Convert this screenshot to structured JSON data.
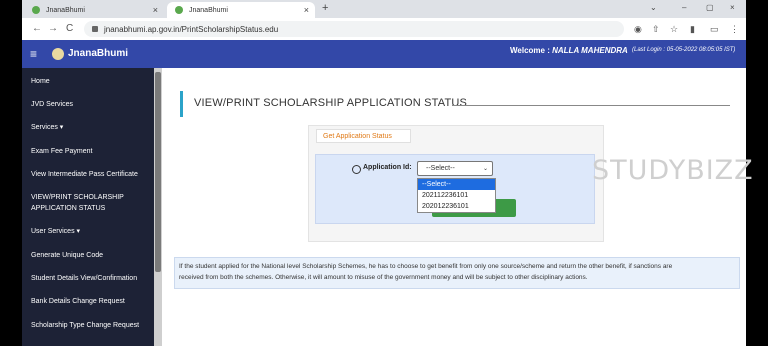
{
  "tabs": [
    {
      "title": "JnanaBhumi",
      "close": "×"
    },
    {
      "title": "JnanaBhumi",
      "close": "×"
    }
  ],
  "new_tab": "+",
  "window_controls": [
    "⌄",
    "–",
    "▢",
    "×"
  ],
  "nav": {
    "back": "←",
    "forward": "→",
    "reload": "C"
  },
  "url": "jnanabhumi.ap.gov.in/PrintScholarshipStatus.edu",
  "header": {
    "menu": "≡",
    "brand": "JnanaBhumi",
    "welcome_label": "Welcome :",
    "user": "NALLA MAHENDRA",
    "last_login": "(Last Login : 05-05-2022 08:05:05 IST)"
  },
  "sidebar": {
    "items": [
      "Home",
      "JVD Services",
      "Services ▾",
      "Exam Fee Payment",
      "View Intermediate Pass Certificate",
      "VIEW/PRINT SCHOLARSHIP",
      "APPLICATION STATUS",
      "User Services ▾",
      "Generate Unique Code",
      "Student Details View/Confirmation",
      "Bank Details Change Request",
      "Scholarship Type Change Request"
    ]
  },
  "page": {
    "title": "VIEW/PRINT SCHOLARSHIP APPLICATION STATUS",
    "tab_label": "Get Application Status",
    "field_label": "Application Id:",
    "select_value": "--Select--",
    "options": [
      "--Select--",
      "202112236101",
      "202012236101"
    ],
    "notice_line1": "If the student applied for the National level Scholarship Schemes, he has to choose to get benefit from only one source/scheme and return the other benefit, if sanctions are",
    "notice_line2": "received from both the schemes. Otherwise, it will amount to misuse of the government money and will be subject to other disciplinary actions."
  },
  "watermark": "STUDYBIZZ",
  "colors": {
    "header": "#3348a8",
    "sidebar": "#1d2236",
    "accent": "#2ba3c9",
    "tab_text": "#e07a17",
    "button": "#3d9a46"
  }
}
